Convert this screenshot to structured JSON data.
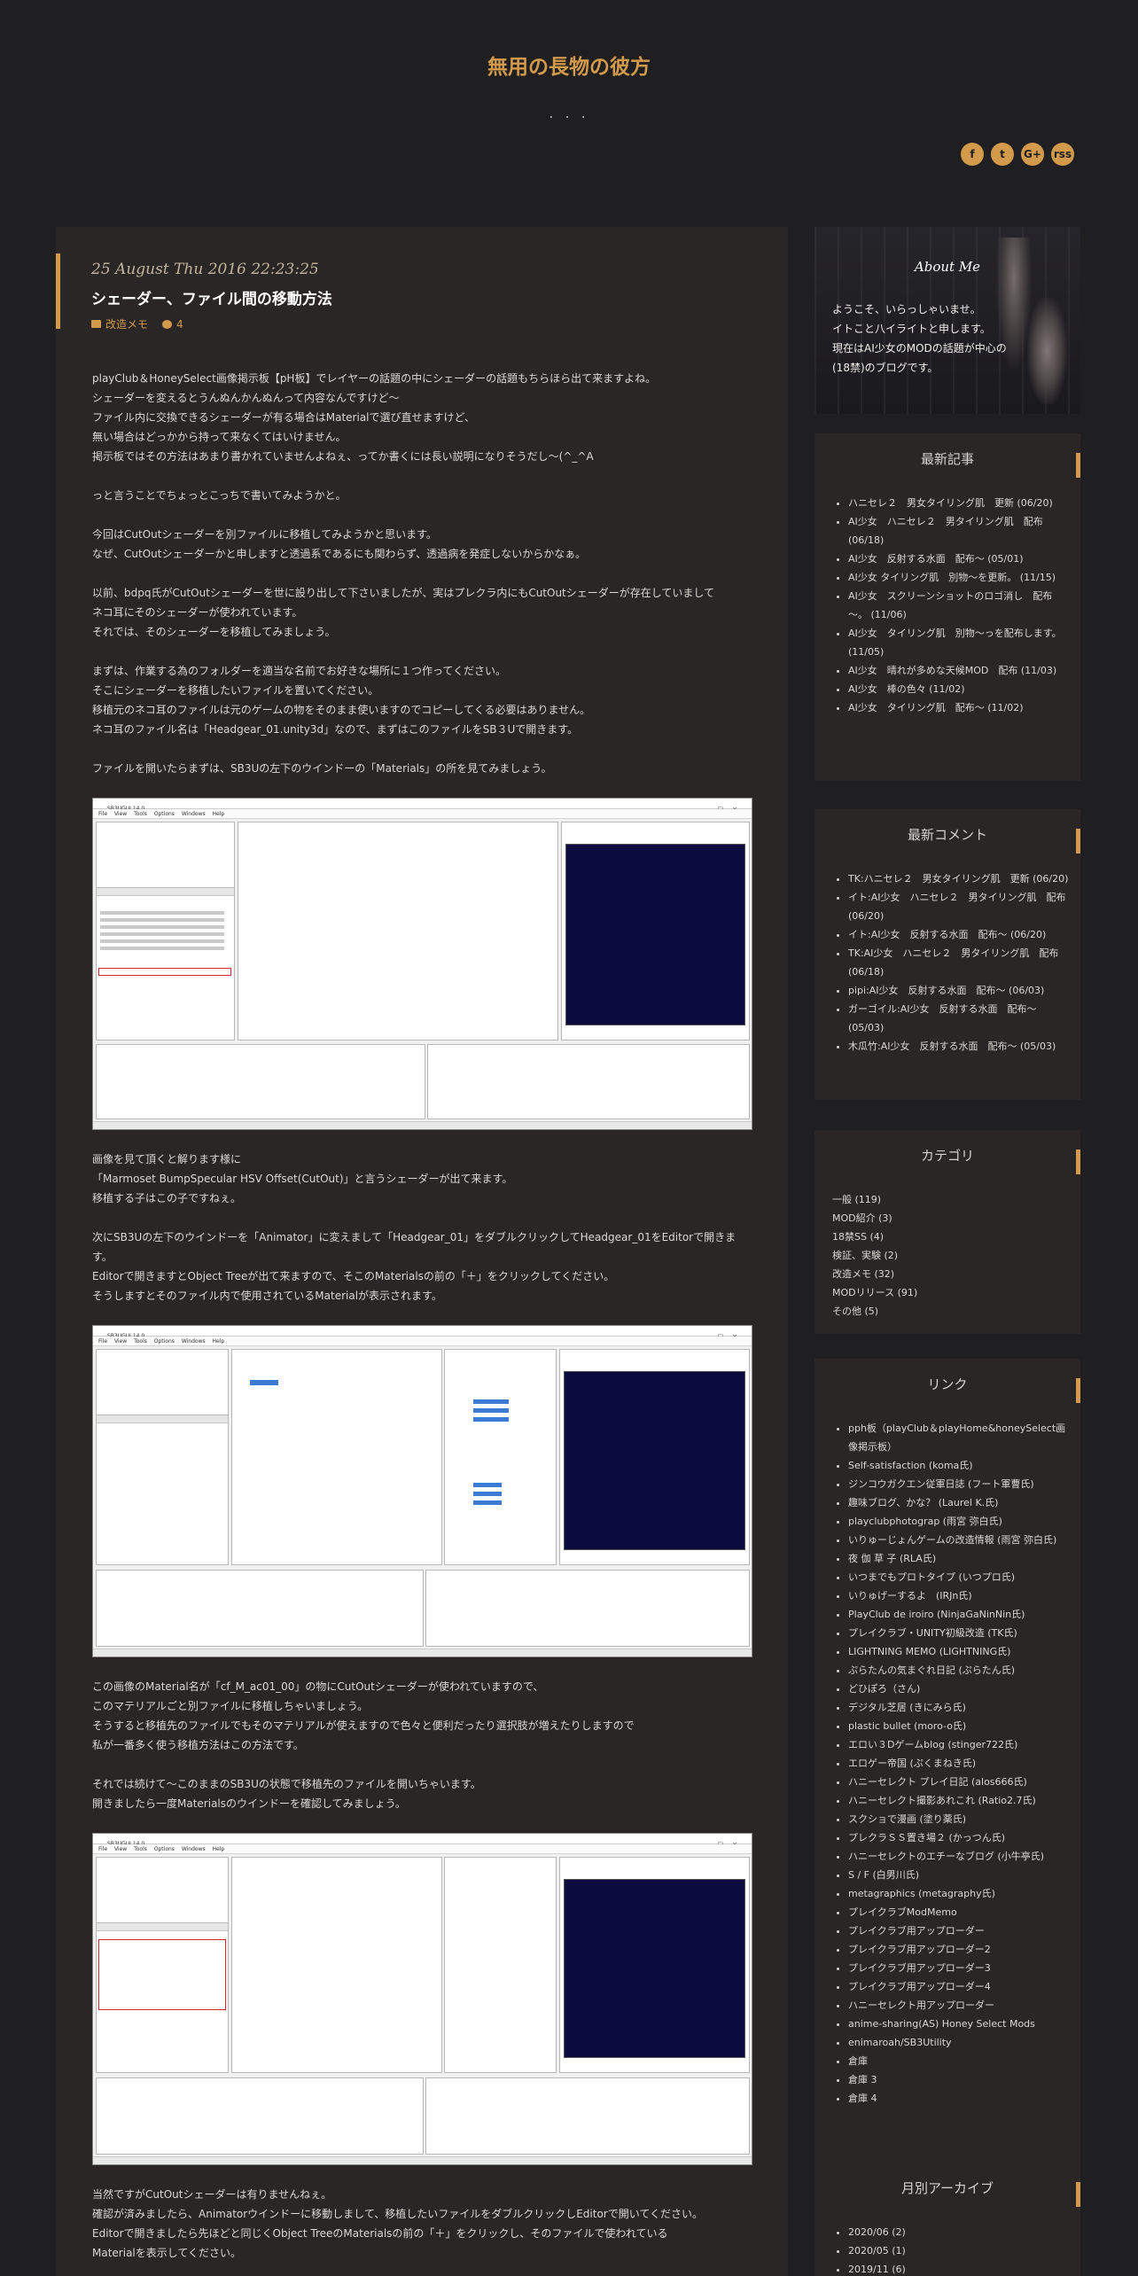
{
  "site": {
    "title": "無用の長物の彼方",
    "description": ". . ."
  },
  "social": [
    "f",
    "t",
    "G+",
    "rss"
  ],
  "post": {
    "date": "25 August Thu 2016 22:23:25",
    "title": "シェーダー、ファイル間の移動方法",
    "category": "改造メモ",
    "comments": "4",
    "paragraphs": [
      "playClub＆HoneySelect画像掲示板【pH板】でレイヤーの話題の中にシェーダーの話題もちらほら出て来ますよね。\nシェーダーを変えるとうんぬんかんぬんって内容なんですけど～\nファイル内に交換できるシェーダーが有る場合はMaterialで選び直せますけど、\n無い場合はどっかから持って来なくてはいけません。\n掲示板ではその方法はあまり書かれていませんよねぇ、ってか書くには長い説明になりそうだし～(^_^A",
      "っと言うことでちょっとこっちで書いてみようかと。",
      "今回はCutOutシェーダーを別ファイルに移植してみようかと思います。\nなぜ、CutOutシェーダーかと申しますと透過系であるにも関わらず、透過病を発症しないからかなぁ。",
      "以前、bdpq氏がCutOutシェーダーを世に設り出して下さいましたが、実はプレクラ内にもCutOutシェーダーが存在していまして\nネコ耳にそのシェーダーが使われています。\nそれでは、そのシェーダーを移植してみましょう。",
      "まずは、作業する為のフォルダーを適当な名前でお好きな場所に１つ作ってください。\nそこにシェーダーを移植したいファイルを置いてください。\n移植元のネコ耳のファイルは元のゲームの物をそのまま使いますのでコピーしてくる必要はありません。\nネコ耳のファイル名は「Headgear_01.unity3d」なので、まずはこのファイルをSB３Uで開きます。",
      "ファイルを開いたらまずは、SB3Uの左下のウインドーの「Materials」の所を見てみましょう。",
      "画像を見て頂くと解ります様に\n「Marmoset BumpSpecular HSV Offset(CutOut)」と言うシェーダーが出て来ます。\n移植する子はこの子ですねぇ。",
      "次にSB3Uの左下のウインドーを「Animator」に変えまして「Headgear_01」をダブルクリックしてHeadgear_01をEditorで開きます。\nEditorで開きますとObject Treeが出て来ますので、そこのMaterialsの前の「＋」をクリックしてください。\nそうしますとそのファイル内で使用されているMaterialが表示されます。",
      "この画像のMaterial名が「cf_M_ac01_00」の物にCutOutシェーダーが使われていますので、\nこのマテリアルごと別ファイルに移植しちゃいましょう。\nそうすると移植先のファイルでもそのマテリアルが使えますので色々と便利だったり選択肢が増えたりしますので\n私が一番多く使う移植方法はこの方法です。",
      "それでは続けて～このままのSB3Uの状態で移植先のファイルを開いちゃいます。\n開きましたら一度Materialsのウインドーを確認してみましょう。",
      "当然ですがCutOutシェーダーは有りませんねぇ。\n確認が済みましたら、Animatorウインドーに移動しまして、移植したいファイルをダブルクリックしEditorで開いてください。\nEditorで開きましたら先ほどと同じくObject TreeのMaterialsの前の「＋」をクリックし、そのファイルで使われている\nMaterialを表示してください。"
    ],
    "screenshot_title": "SB3UGUI 14.0",
    "screenshot_menu": "File View Tools Options Windows Help"
  },
  "about": {
    "title": "About Me",
    "text": "ようこそ、いらっしゃいませ。\nイトこと八イライトと申します。\n現在はAI少女のMODの話題が中心の\n(18禁)のブログです。"
  },
  "recent": {
    "title": "最新記事",
    "items": [
      "ハニセレ２　男女タイリング肌　更新 (06/20)",
      "AI少女　ハニセレ２　男タイリング肌　配布 (06/18)",
      "AI少女　反射する水面　配布～ (05/01)",
      "AI少女 タイリング肌　別物～を更新。 (11/15)",
      "AI少女　スクリーンショットのロゴ消し　配布～。 (11/06)",
      "AI少女　タイリング肌　別物～っを配布します。 (11/05)",
      "AI少女　晴れが多めな天候MOD　配布 (11/03)",
      "AI少女　棒の色々 (11/02)",
      "AI少女　タイリング肌　配布～ (11/02)"
    ]
  },
  "comments": {
    "title": "最新コメント",
    "items": [
      "TK:ハニセレ２　男女タイリング肌　更新 (06/20)",
      "イト:AI少女　ハニセレ２　男タイリング肌　配布 (06/20)",
      "イト:AI少女　反射する水面　配布～ (06/20)",
      "TK:AI少女　ハニセレ２　男タイリング肌　配布 (06/18)",
      "pipi:AI少女　反射する水面　配布～ (06/03)",
      "ガーゴイル:AI少女　反射する水面　配布～ (05/03)",
      "木瓜竹:AI少女　反射する水面　配布～ (05/03)"
    ]
  },
  "categories": {
    "title": "カテゴリ",
    "items": [
      "一般 (119)",
      "MOD紹介 (3)",
      "18禁SS (4)",
      "検証、実験 (2)",
      "改造メモ (32)",
      "MODリリース (91)",
      "その他 (5)"
    ]
  },
  "links": {
    "title": "リンク",
    "items": [
      "pph板（playClub＆playHome&honeySelect画像掲示板）",
      "Self-satisfaction (koma氏)",
      "ジンコウガクエン従軍日誌 (フート軍曹氏)",
      "趣味ブログ、かな？ (Laurel K.氏)",
      "playclubphotograp (雨宮 弥白氏)",
      "いりゅーじょんゲームの改造情報 (雨宮 弥白氏)",
      "夜 伽 草 子 (RLA氏)",
      "いつまでもプロトタイプ (いつプロ氏)",
      "いりゅげーするよ　(IRJn氏)",
      "PlayClub de iroiro (NinjaGaNinNin氏)",
      "プレイクラブ・UNITY初級改造 (TK氏)",
      "LIGHTNING MEMO (LIGHTNING氏)",
      "ぷらたんの気まぐれ日記 (ぷらたん氏)",
      "どひぽろ（さん)",
      "デジタル芝居 (きにみら氏)",
      "plastic bullet (moro-o氏)",
      "エロい３Dゲームblog (stinger722氏)",
      "エロゲー帝国 (ぷくまねき氏)",
      "ハニーセレクト プレイ日記 (alos666氏)",
      "ハニーセレクト撮影あれこれ (Ratio2.7氏)",
      "スクショで漫画 (塗り薬氏)",
      "プレクラＳＳ置き場２ (かっつん氏)",
      "ハニーセレクトのエチーなブログ (小牛亭氏)",
      "S / F (白男川氏)",
      "metagraphics (metagraphy氏)",
      "プレイクラブModMemo",
      "プレイクラブ用アップローダー",
      "プレイクラブ用アップローダー2",
      "プレイクラブ用アップローダー3",
      "プレイクラブ用アップローダー4",
      "ハニーセレクト用アップローダー",
      "anime-sharing(AS) Honey Select Mods",
      "enimaroah/SB3Utility",
      "倉庫",
      "倉庫 3",
      "倉庫 4"
    ]
  },
  "archive": {
    "title": "月別アーカイブ",
    "items": [
      "2020/06 (2)",
      "2020/05 (1)",
      "2019/11 (6)"
    ]
  },
  "colors": {
    "accent": "#d49a4b",
    "background": "#1f1f22",
    "panel": "#2a2626"
  }
}
